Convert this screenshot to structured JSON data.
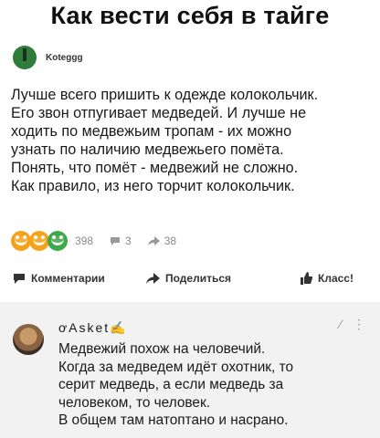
{
  "title": "Как вести себя в тайге",
  "author": {
    "name": "Koteggg",
    "avatar_color": "#2f7d3a"
  },
  "post": {
    "text": "Лучше всего пришить к одежде колокольчик.\nЕго звон отпугивает медведей. И лучше не\nходить по медвежьим тропам - их можно\nузнать по наличию медвежьего помёта.\nПонять, что помёт - медвежий не сложно.\nКак правило, из него торчит колокольчик."
  },
  "stats": {
    "reactions": "398",
    "comments": "3",
    "shares": "38"
  },
  "actions": {
    "comments_label": "Комментарии",
    "share_label": "Поделиться",
    "like_label": "Класс!"
  },
  "comment": {
    "author": "ơAsket✍",
    "menu": "⁄ ⋮",
    "text": "Медвежий похож на человечий.\nКогда за медведем идёт охотник, то\nсерит медведь, а если медведь за\nчеловеком, то человек.\nВ общем там натоптано и насрано."
  }
}
